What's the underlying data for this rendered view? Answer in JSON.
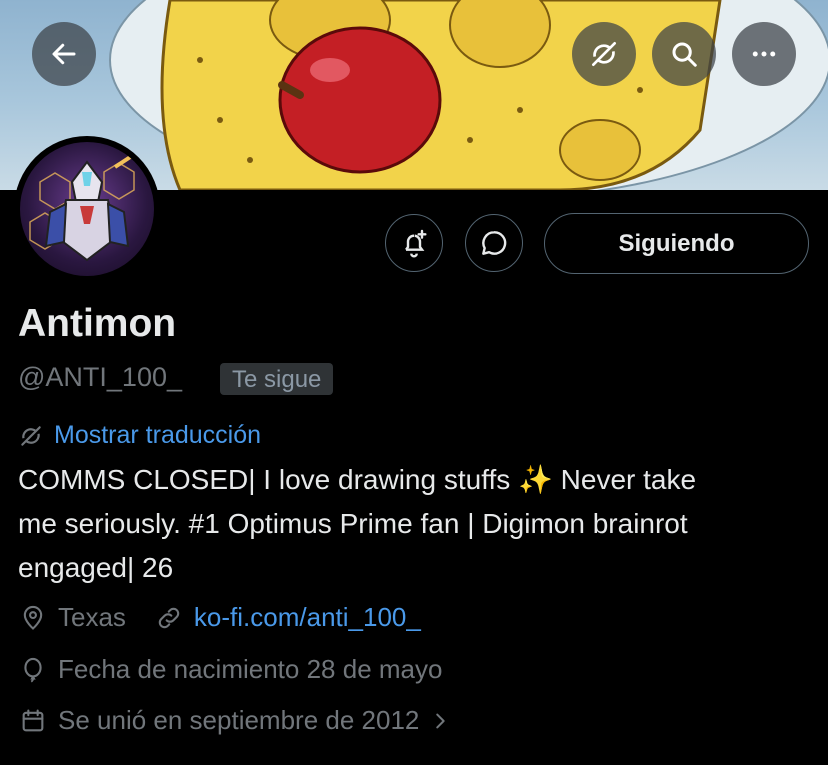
{
  "profile": {
    "display_name": "Antimon",
    "handle": "@ANTI_100_",
    "follows_you": "Te sigue",
    "translate": "Mostrar traducción",
    "bio_line1": "COMMS CLOSED| I love drawing stuffs ✨ Never take",
    "bio_line2": "me seriously. #1 Optimus Prime fan | Digimon brainrot",
    "bio_line3": "engaged| 26",
    "location": "Texas",
    "website": "ko-fi.com/anti_100_",
    "birthday": "Fecha de nacimiento 28 de mayo",
    "joined": "Se unió en septiembre de 2012"
  },
  "actions": {
    "following_label": "Siguiendo"
  },
  "icons": {
    "back": "arrow-left-icon",
    "translate": "translate-icon",
    "search": "search-icon",
    "more": "more-icon",
    "notify": "bell-plus-icon",
    "message": "chat-bubble-icon",
    "location": "location-pin-icon",
    "link": "link-icon",
    "birthday": "balloon-icon",
    "joined": "calendar-icon"
  },
  "colors": {
    "background": "#000000",
    "text": "#e7e9ea",
    "muted": "#71767b",
    "link": "#4a99e9",
    "border": "#536471"
  }
}
